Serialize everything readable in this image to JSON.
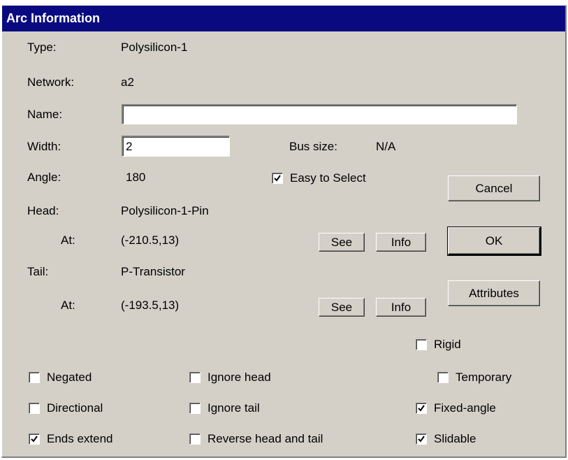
{
  "window": {
    "title": "Arc Information"
  },
  "labels": {
    "type": "Type:",
    "network": "Network:",
    "name": "Name:",
    "width": "Width:",
    "angle": "Angle:",
    "head": "Head:",
    "head_at": "At:",
    "tail": "Tail:",
    "tail_at": "At:",
    "bus_size": "Bus size:"
  },
  "values": {
    "type": "Polysilicon-1",
    "network": "a2",
    "angle": "180",
    "head": "Polysilicon-1-Pin",
    "head_at": "(-210.5,13)",
    "tail": "P-Transistor",
    "tail_at": "(-193.5,13)",
    "bus_size": "N/A"
  },
  "inputs": {
    "name": "",
    "width": "2"
  },
  "buttons": {
    "cancel": "Cancel",
    "ok": "OK",
    "attributes": "Attributes",
    "head_see": "See",
    "head_info": "Info",
    "tail_see": "See",
    "tail_info": "Info"
  },
  "checkboxes": {
    "easy_to_select": {
      "label": "Easy to Select",
      "checked": true
    },
    "rigid": {
      "label": "Rigid",
      "checked": false
    },
    "negated": {
      "label": "Negated",
      "checked": false
    },
    "ignore_head": {
      "label": "Ignore head",
      "checked": false
    },
    "temporary": {
      "label": "Temporary",
      "checked": false
    },
    "directional": {
      "label": "Directional",
      "checked": false
    },
    "ignore_tail": {
      "label": "Ignore tail",
      "checked": false
    },
    "fixed_angle": {
      "label": "Fixed-angle",
      "checked": true
    },
    "ends_extend": {
      "label": "Ends extend",
      "checked": true
    },
    "reverse_head_tail": {
      "label": "Reverse head and tail",
      "checked": false
    },
    "slidable": {
      "label": "Slidable",
      "checked": true
    }
  },
  "icons": {
    "checkmark": "checkmark-icon"
  }
}
